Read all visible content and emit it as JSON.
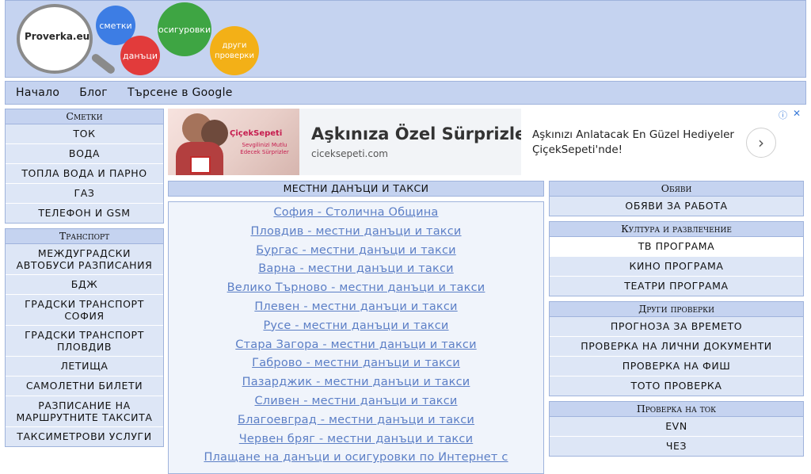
{
  "logo": {
    "text": "Proverka.eu",
    "bubbles": [
      "сметки",
      "данъци",
      "осигуровки",
      "други проверки"
    ]
  },
  "nav": [
    "Начало",
    "Блог",
    "Търсене в Google"
  ],
  "left": [
    {
      "title": "Сметки",
      "items": [
        "ТОК",
        "ВОДА",
        "ТОПЛА ВОДА И ПАРНО",
        "ГАЗ",
        "ТЕЛЕФОН И GSM"
      ]
    },
    {
      "title": "Транспорт",
      "items": [
        "МЕЖДУГРАДСКИ АВТОБУСИ РАЗПИСАНИЯ",
        "БДЖ",
        "ГРАДСКИ ТРАНСПОРТ СОФИЯ",
        "ГРАДСКИ ТРАНСПОРТ ПЛОВДИВ",
        "ЛЕТИЩА",
        "САМОЛЕТНИ БИЛЕТИ",
        "РАЗПИСАНИЕ НА МАРШРУТНИТЕ ТАКСИТА",
        "ТАКСИМЕТРОВИ УСЛУГИ"
      ]
    }
  ],
  "ad": {
    "brand": "ÇiçekSepeti",
    "brand_sub": "Sevgilinizi Mutlu Edecek Sürprizler",
    "title": "Aşkınıza Özel Sürprizler",
    "domain": "ciceksepeti.com",
    "description": "Aşkınızı Anlatacak En Güzel Hediyeler ÇiçekSepeti'nde!",
    "arrow": "›",
    "info": "ⓘ",
    "close": "✕"
  },
  "middle": {
    "title": "МЕСТНИ ДАНЪЦИ И ТАКСИ",
    "links": [
      "София - Столична Община",
      "Пловдив - местни данъци и такси",
      "Бургас - местни данъци и такси",
      "Варна - местни данъци и такси",
      "Велико Търново - местни данъци и такси",
      "Плевен - местни данъци и такси",
      "Русе - местни данъци и такси",
      "Стара Загора - местни данъци и такси",
      "Габрово - местни данъци и такси",
      "Пазарджик - местни данъци и такси",
      "Сливен - местни данъци и такси",
      "Благоевград - местни данъци и такси",
      "Червен бряг - местни данъци и такси",
      "Плащане на данъци и осигуровки по Интернет с"
    ]
  },
  "right": [
    {
      "title": "Обяви",
      "items": [
        "ОБЯВИ ЗА РАБОТА"
      ]
    },
    {
      "title": "Култура и развлечение",
      "items": [
        "ТВ ПРОГРАМА",
        "КИНО ПРОГРАМА",
        "ТЕАТРИ ПРОГРАМА"
      ]
    },
    {
      "title": "Други проверки",
      "items": [
        "ПРОГНОЗА ЗА ВРЕМЕТО",
        "ПРОВЕРКА НА ЛИЧНИ ДОКУМЕНТИ",
        "ПРОВЕРКА НА ФИШ",
        "ТОТО ПРОВЕРКА"
      ]
    },
    {
      "title": "Проверка на ток",
      "items": [
        "EVN",
        "ЧЕЗ"
      ]
    }
  ]
}
